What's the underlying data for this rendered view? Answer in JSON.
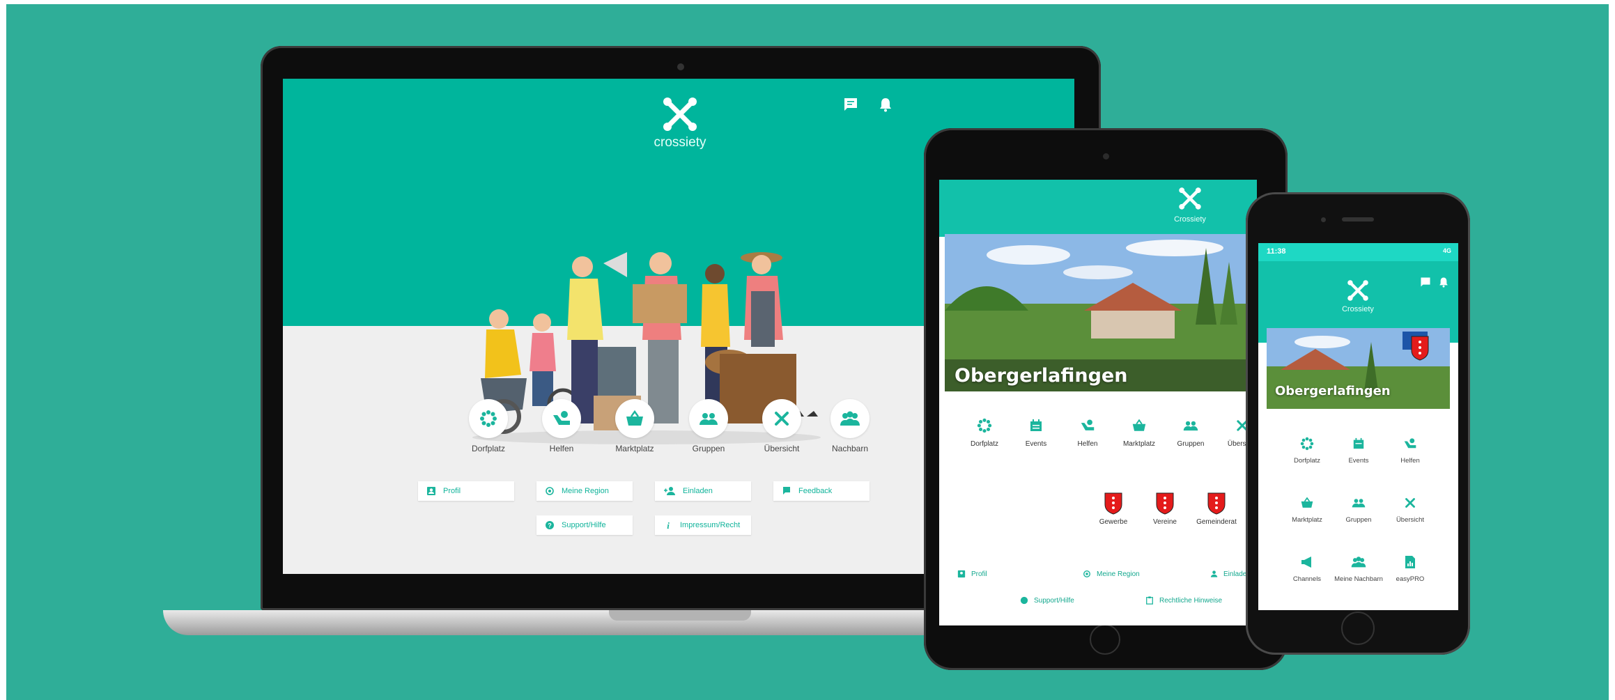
{
  "brand": "crossiety",
  "brand_tablet": "Crossiety",
  "colors": {
    "backdrop": "#2fae98",
    "header": "#00b59c",
    "accent": "#0fb39a",
    "crest": "#e41b1b"
  },
  "desktop": {
    "nav": [
      {
        "label": "Dorfplatz",
        "icon": "dorfplatz-icon"
      },
      {
        "label": "Helfen",
        "icon": "helfen-icon"
      },
      {
        "label": "Marktplatz",
        "icon": "basket-icon"
      },
      {
        "label": "Gruppen",
        "icon": "groups-icon"
      },
      {
        "label": "Übersicht",
        "icon": "crossiety-x-icon"
      },
      {
        "label": "Nachbarn",
        "icon": "neighbors-icon"
      }
    ],
    "links": [
      {
        "label": "Profil",
        "icon": "profile-card-icon"
      },
      {
        "label": "Meine Region",
        "icon": "target-icon"
      },
      {
        "label": "Einladen",
        "icon": "add-user-icon"
      },
      {
        "label": "Feedback",
        "icon": "flag-icon"
      },
      {
        "label": "Support/Hilfe",
        "icon": "help-icon"
      },
      {
        "label": "Impressum/Recht",
        "icon": "info-icon"
      }
    ]
  },
  "tablet": {
    "town": "Obergerlafingen",
    "nav": [
      {
        "label": "Dorfplatz"
      },
      {
        "label": "Events"
      },
      {
        "label": "Helfen"
      },
      {
        "label": "Marktplatz"
      },
      {
        "label": "Gruppen"
      },
      {
        "label": "Übersicht"
      }
    ],
    "crests": [
      {
        "label": "Gewerbe"
      },
      {
        "label": "Vereine"
      },
      {
        "label": "Gemeinderat"
      }
    ],
    "links": [
      {
        "label": "Profil"
      },
      {
        "label": "Meine Region"
      },
      {
        "label": "Einladen"
      },
      {
        "label": "Support/Hilfe"
      },
      {
        "label": "Rechtliche Hinweise"
      }
    ]
  },
  "phone": {
    "status_time": "11:38",
    "status_right": "4G",
    "town": "Obergerlafingen",
    "nav": [
      {
        "label": "Dorfplatz"
      },
      {
        "label": "Events"
      },
      {
        "label": "Helfen"
      },
      {
        "label": "Marktplatz"
      },
      {
        "label": "Gruppen"
      },
      {
        "label": "Übersicht"
      },
      {
        "label": "Channels"
      },
      {
        "label": "Meine Nachbarn"
      },
      {
        "label": "easyPRO"
      }
    ]
  }
}
